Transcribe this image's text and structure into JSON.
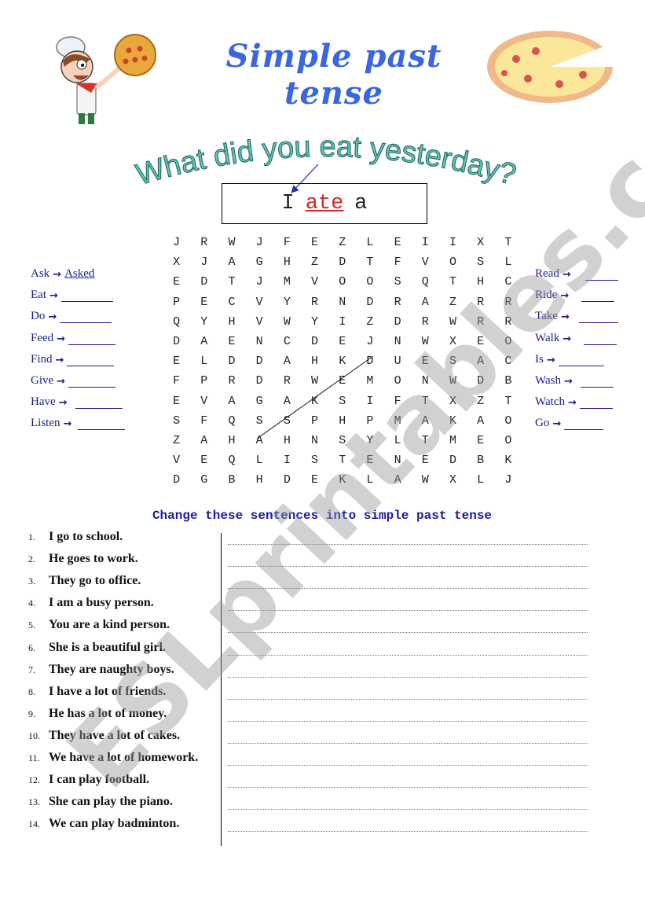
{
  "header": {
    "title": "Simple past tense",
    "left_image": "chef-with-pizza-illustration",
    "right_image": "pizza-illustration"
  },
  "subtitle": "What did you eat yesterday?",
  "answer_box": {
    "word1": "I",
    "word2": "ate",
    "word3": "a"
  },
  "colors": {
    "title": "#3a66e0",
    "subtitle": "#5ec7b8",
    "verbs": "#1a1a8c",
    "instruction": "#1a1aa8",
    "highlight": "#d02a2a"
  },
  "word_search": {
    "rows": [
      [
        "J",
        "R",
        "W",
        "J",
        "F",
        "E",
        "Z",
        "L",
        "E",
        "I",
        "I",
        "X",
        "T"
      ],
      [
        "X",
        "J",
        "A",
        "G",
        "H",
        "Z",
        "D",
        "T",
        "F",
        "V",
        "O",
        "S",
        "L"
      ],
      [
        "E",
        "D",
        "T",
        "J",
        "M",
        "V",
        "O",
        "O",
        "S",
        "Q",
        "T",
        "H",
        "C"
      ],
      [
        "P",
        "E",
        "C",
        "V",
        "Y",
        "R",
        "N",
        "D",
        "R",
        "A",
        "Z",
        "R",
        "R"
      ],
      [
        "Q",
        "Y",
        "H",
        "V",
        "W",
        "Y",
        "I",
        "Z",
        "D",
        "R",
        "W",
        "R",
        "R"
      ],
      [
        "D",
        "A",
        "E",
        "N",
        "C",
        "D",
        "E",
        "J",
        "N",
        "W",
        "X",
        "E",
        "O"
      ],
      [
        "E",
        "L",
        "D",
        "D",
        "A",
        "H",
        "K",
        "D",
        "U",
        "E",
        "S",
        "A",
        "C"
      ],
      [
        "F",
        "P",
        "R",
        "D",
        "R",
        "W",
        "E",
        "M",
        "O",
        "N",
        "W",
        "D",
        "B"
      ],
      [
        "E",
        "V",
        "A",
        "G",
        "A",
        "K",
        "S",
        "I",
        "F",
        "T",
        "X",
        "Z",
        "T"
      ],
      [
        "S",
        "F",
        "Q",
        "S",
        "S",
        "P",
        "H",
        "P",
        "M",
        "A",
        "K",
        "A",
        "O"
      ],
      [
        "Z",
        "A",
        "H",
        "A",
        "H",
        "N",
        "S",
        "Y",
        "L",
        "T",
        "M",
        "E",
        "O"
      ],
      [
        "V",
        "E",
        "Q",
        "L",
        "I",
        "S",
        "T",
        "E",
        "N",
        "E",
        "D",
        "B",
        "K"
      ],
      [
        "D",
        "G",
        "B",
        "H",
        "D",
        "E",
        "K",
        "L",
        "A",
        "W",
        "X",
        "L",
        "J"
      ]
    ],
    "example_found_word": "ASKED"
  },
  "verbs_left": [
    {
      "verb": "Ask",
      "answer": "Asked"
    },
    {
      "verb": "Eat",
      "answer": ""
    },
    {
      "verb": "Do",
      "answer": ""
    },
    {
      "verb": "Feed",
      "answer": ""
    },
    {
      "verb": "Find",
      "answer": ""
    },
    {
      "verb": "Give",
      "answer": ""
    },
    {
      "verb": "Have",
      "answer": ""
    },
    {
      "verb": "Listen",
      "answer": ""
    }
  ],
  "verbs_right": [
    {
      "verb": "Read",
      "answer": ""
    },
    {
      "verb": "Ride",
      "answer": ""
    },
    {
      "verb": "Take",
      "answer": ""
    },
    {
      "verb": "Walk",
      "answer": ""
    },
    {
      "verb": "Is",
      "answer": ""
    },
    {
      "verb": "Wash",
      "answer": ""
    },
    {
      "verb": "Watch",
      "answer": ""
    },
    {
      "verb": "Go",
      "answer": ""
    }
  ],
  "arrow_glyph": "→",
  "instruction": "Change these sentences into simple past tense",
  "sentences": [
    {
      "num": "1.",
      "text": "I go to school."
    },
    {
      "num": "2.",
      "text": "He goes to work."
    },
    {
      "num": "3.",
      "text": "They go to office."
    },
    {
      "num": "4.",
      "text": "I am a busy person."
    },
    {
      "num": "5.",
      "text": "You are a kind person."
    },
    {
      "num": "6.",
      "text": "She is a beautiful girl."
    },
    {
      "num": "7.",
      "text": "They are naughty boys."
    },
    {
      "num": "8.",
      "text": "I have a lot of friends."
    },
    {
      "num": "9.",
      "text": "He has a lot of money."
    },
    {
      "num": "10.",
      "text": "They have a lot of cakes."
    },
    {
      "num": "11.",
      "text": "We have a lot of homework."
    },
    {
      "num": "12.",
      "text": "I can play football."
    },
    {
      "num": "13.",
      "text": "She can play the piano."
    },
    {
      "num": "14.",
      "text": "We can play badminton."
    }
  ],
  "watermark": "ESLprintables.com"
}
